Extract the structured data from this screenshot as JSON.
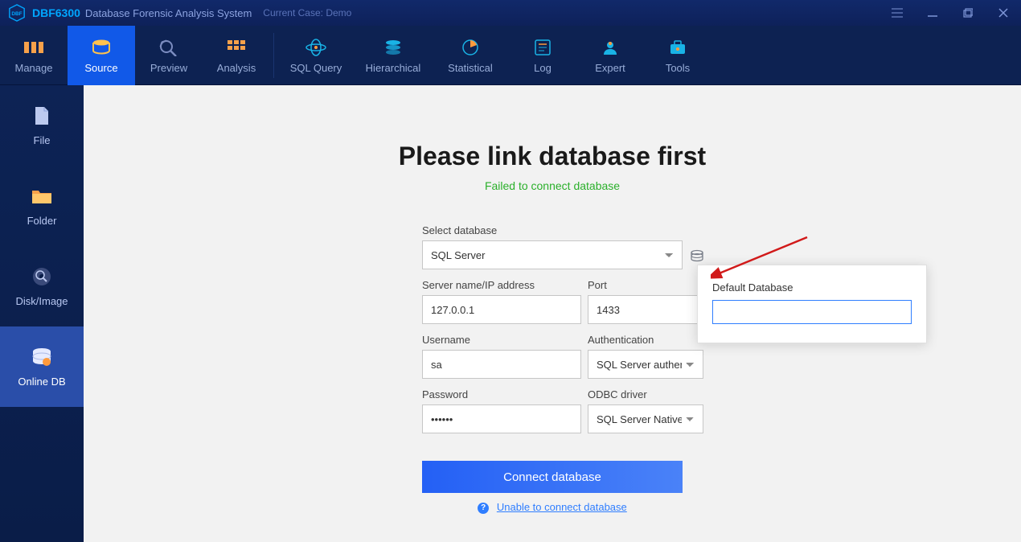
{
  "title": {
    "product": "DBF6300",
    "desc": "Database Forensic Analysis System",
    "case": "Current Case: Demo"
  },
  "nav": {
    "manage": "Manage",
    "source": "Source",
    "preview": "Preview",
    "analysis": "Analysis",
    "sqlquery": "SQL Query",
    "hierarchical": "Hierarchical",
    "statistical": "Statistical",
    "log": "Log",
    "expert": "Expert",
    "tools": "Tools"
  },
  "sidebar": {
    "file": "File",
    "folder": "Folder",
    "disk": "Disk/Image",
    "onlinedb": "Online DB"
  },
  "main": {
    "headline": "Please link database first",
    "status": "Failed to connect database",
    "labels": {
      "select_db": "Select database",
      "server": "Server name/IP address",
      "port": "Port",
      "username": "Username",
      "auth": "Authentication",
      "password": "Password",
      "odbc": "ODBC driver"
    },
    "values": {
      "select_db": "SQL Server",
      "server": "127.0.0.1",
      "port": "1433",
      "username": "sa",
      "auth": "SQL Server authen",
      "password_mask": "••••••",
      "odbc": "SQL Server Native"
    },
    "connect_label": "Connect database",
    "help_link": "Unable to connect database"
  },
  "popover": {
    "label": "Default Database",
    "value": ""
  }
}
